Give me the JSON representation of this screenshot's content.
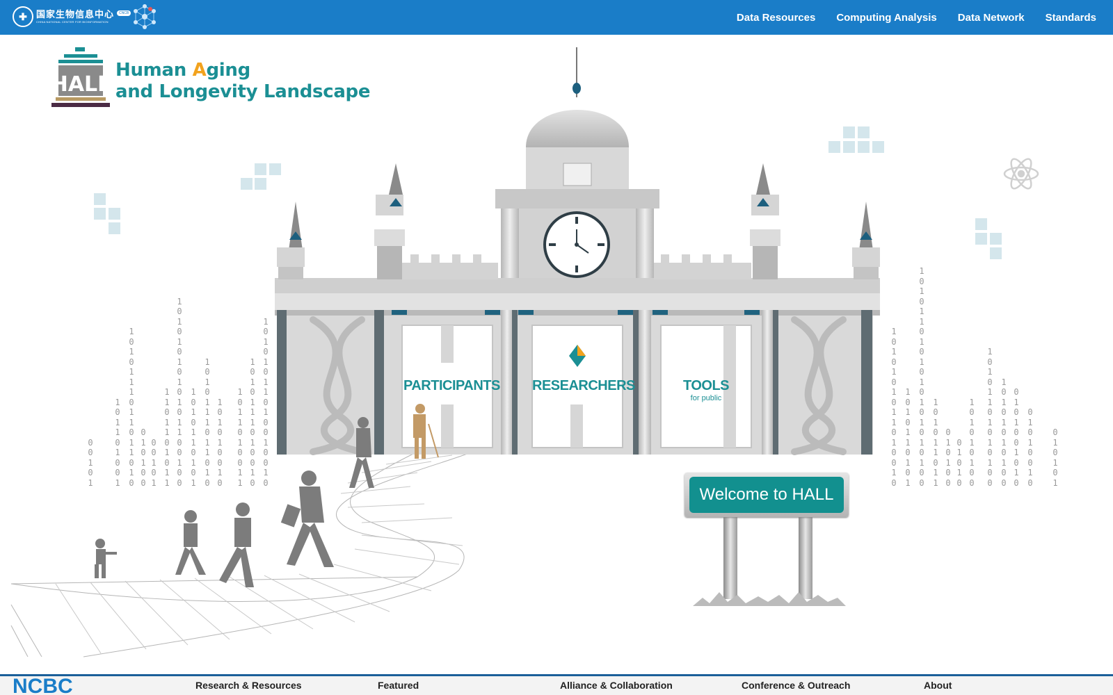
{
  "header": {
    "org_name_cn": "国家生物信息中心",
    "org_name_en": "CHINA NATIONAL CENTER FOR BIOINFORMATION",
    "org_badge": "CNCB",
    "nav": [
      "Data Resources",
      "Computing Analysis",
      "Data Network",
      "Standards"
    ]
  },
  "hero": {
    "logo_text": "HALL",
    "title_line1_pre": "Human ",
    "title_line1_accent": "A",
    "title_line1_post": "ging",
    "title_line2": "and Longevity Landscape",
    "doors": {
      "participants": "PARTICIPANTS",
      "researchers": "RESEARCHERS",
      "tools": "TOOLS",
      "tools_sub": "for public"
    },
    "welcome": "Welcome to HALL"
  },
  "binary_columns": [
    "0\n0\n1\n0\n1",
    "1\n0\n1\n1\n0\n1\n0\n0\n1",
    "1\n0\n1\n0\n1\n1\n1\n0\n1\n1\n0\n1\n1\n0\n1\n0",
    "0\n1\n0\n1\n0\n0",
    "0\n0\n1\n0\n1",
    "1\n1\n0\n1\n1\n0\n1\n0\n1\n1",
    "1\n0\n1\n0\n1\n0\n1\n0\n1\n0\n1\n0\n1\n1\n0\n0\n1\n0\n0",
    "1\n0\n1\n0\n1\n1\n0\n1\n0\n1",
    "1\n0\n1\n0\n1\n1\n1\n0\n1\n1\n0\n1\n0",
    "1\n0\n1\n0\n1\n0\n0\n1\n0",
    "1\n0\n1\n1\n0\n1\n0\n0\n1\n1",
    "1\n0\n1\n0\n1\n1\n1\n0\n1\n0\n0\n1\n0",
    "1\n0\n1\n0\n1\n0\n1\n1\n0\n1\n0\n0\n1\n0\n0\n1\n0",
    "1\n0\n1\n0\n1\n0\n1\n0\n1\n1\n0\n1\n0\n0\n1\n0",
    "1\n0\n1\n0\n1\n1\n0\n1\n0\n1",
    "1\n0\n1\n0\n1\n1\n0\n1\n0\n1\n0\n1\n0\n1\n0\n1\n0\n1\n0\n1\n0\n0",
    "1\n0\n1\n0\n1\n1\n0\n1\n1",
    "0\n1\n0\n1\n0\n0",
    "0\n1\n0\n1\n0",
    "1\n0\n1\n0\n1\n0\n1\n0\n0",
    "1\n0\n1\n0\n1\n1\n0\n1\n0\n1\n0\n1\n0\n0",
    "1\n0\n1\n0\n1\n0\n1\n0\n1\n0\n0",
    "0\n1\n0\n1\n0\n0\n1\n0\n1\n0",
    "0\n1\n0\n1\n0\n0\n1\n0",
    "0\n1\n0\n1\n0\n1"
  ],
  "footer": {
    "logo": "NCBC",
    "columns": [
      "Research & Resources",
      "Featured",
      "Alliance & Collaboration",
      "Conference & Outreach",
      "About"
    ]
  },
  "colors": {
    "nav_bg": "#1a7dc8",
    "brand_teal": "#1b8f94",
    "accent_orange": "#f2a21d",
    "building_gray": "#c9c9c9",
    "footer_rule": "#1a5f99"
  },
  "icons": [
    "ncbc-logo-icon",
    "molecule-icon",
    "atom-icon",
    "clock-icon",
    "dna-icon",
    "diamond-icon"
  ]
}
